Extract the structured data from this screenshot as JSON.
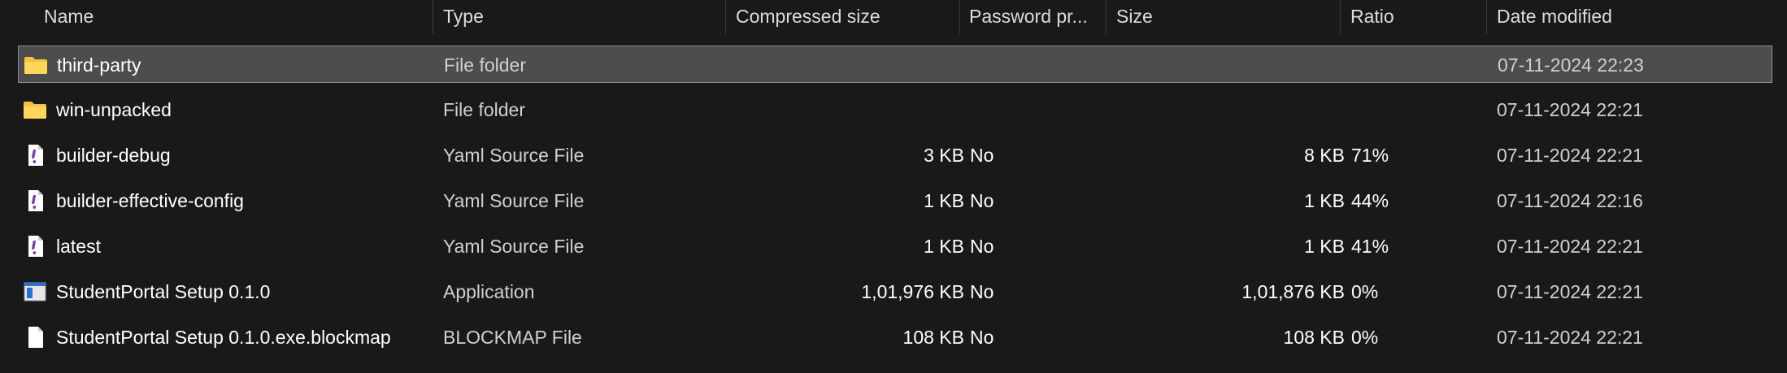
{
  "columns": {
    "name": "Name",
    "type": "Type",
    "compressed": "Compressed size",
    "password": "Password pr...",
    "size": "Size",
    "ratio": "Ratio",
    "date": "Date modified"
  },
  "files": [
    {
      "name": "third-party",
      "icon": "folder-icon",
      "type": "File folder",
      "compressed": "",
      "password": "",
      "size": "",
      "ratio": "",
      "date": "07-11-2024 22:23",
      "selected": true
    },
    {
      "name": "win-unpacked",
      "icon": "folder-icon",
      "type": "File folder",
      "compressed": "",
      "password": "",
      "size": "",
      "ratio": "",
      "date": "07-11-2024 22:21",
      "selected": false
    },
    {
      "name": "builder-debug",
      "icon": "yaml-file-icon",
      "type": "Yaml Source File",
      "compressed": "3 KB",
      "password": "No",
      "size": "8 KB",
      "ratio": "71%",
      "date": "07-11-2024 22:21",
      "selected": false
    },
    {
      "name": "builder-effective-config",
      "icon": "yaml-file-icon",
      "type": "Yaml Source File",
      "compressed": "1 KB",
      "password": "No",
      "size": "1 KB",
      "ratio": "44%",
      "date": "07-11-2024 22:16",
      "selected": false
    },
    {
      "name": "latest",
      "icon": "yaml-file-icon",
      "type": "Yaml Source File",
      "compressed": "1 KB",
      "password": "No",
      "size": "1 KB",
      "ratio": "41%",
      "date": "07-11-2024 22:21",
      "selected": false
    },
    {
      "name": "StudentPortal Setup 0.1.0",
      "icon": "application-icon",
      "type": "Application",
      "compressed": "1,01,976 KB",
      "password": "No",
      "size": "1,01,876 KB",
      "ratio": "0%",
      "date": "07-11-2024 22:21",
      "selected": false
    },
    {
      "name": "StudentPortal Setup 0.1.0.exe.blockmap",
      "icon": "blank-file-icon",
      "type": "BLOCKMAP File",
      "compressed": "108 KB",
      "password": "No",
      "size": "108 KB",
      "ratio": "0%",
      "date": "07-11-2024 22:21",
      "selected": false
    }
  ],
  "colors": {
    "background": "#191919",
    "selection": "#4d4d4d",
    "selection_border": "#8f8f8f",
    "folder": "#f4c242",
    "yaml_accent": "#7a3fa0"
  }
}
